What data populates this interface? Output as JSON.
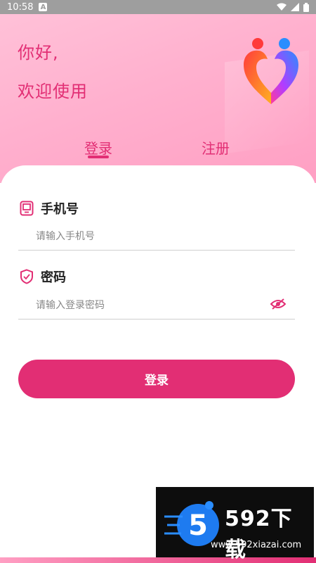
{
  "status_bar": {
    "time": "10:58",
    "app_badge": "A"
  },
  "hero": {
    "greeting_line1": "你好,",
    "greeting_line2": "欢迎使用"
  },
  "tabs": {
    "login": "登录",
    "register": "注册",
    "active": "login"
  },
  "form": {
    "phone_label": "手机号",
    "phone_placeholder": "请输入手机号",
    "password_label": "密码",
    "password_placeholder": "请输入登录密码"
  },
  "login_button": "登录",
  "watermark": {
    "title": "592下载",
    "url": "www.592xiazai.com",
    "logo_digit": "5"
  },
  "icons": {
    "phone_field": "phone-icon",
    "password_field": "shield-icon",
    "toggle_visibility": "eye-off-icon",
    "logo": "couple-heart-logo"
  },
  "colors": {
    "accent": "#e22e74",
    "hero_gradient_start": "#ffc1d8",
    "hero_gradient_end": "#ff9fc3"
  }
}
